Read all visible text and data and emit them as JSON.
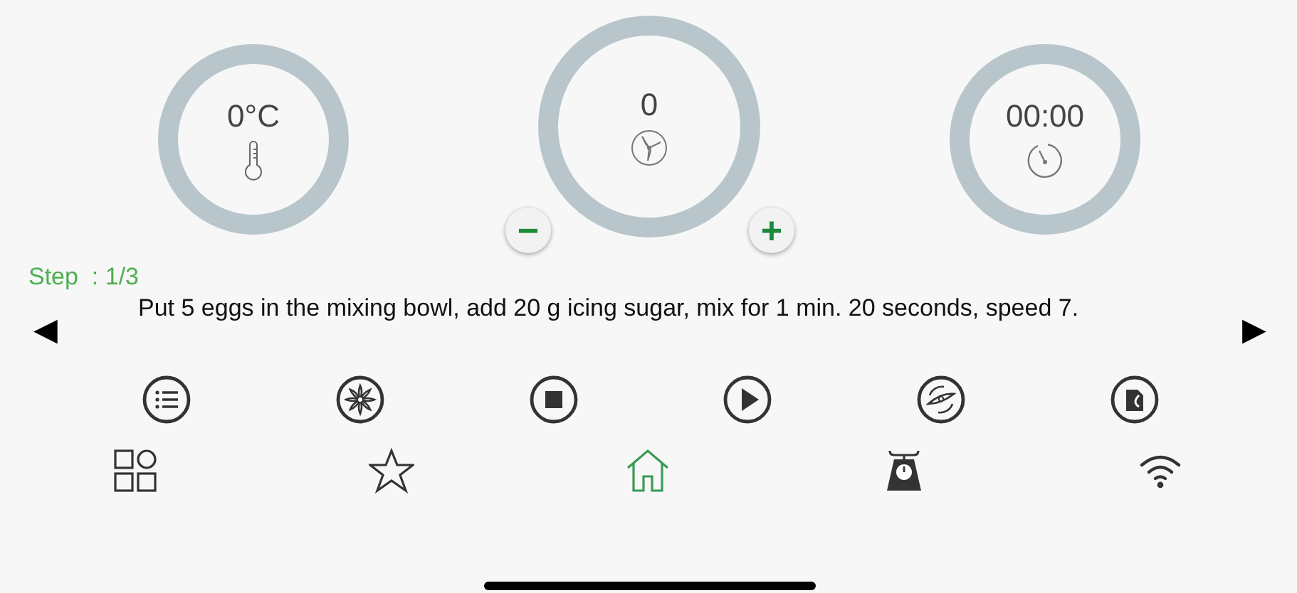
{
  "dials": [
    {
      "kind": "temperature",
      "value": "0°C"
    },
    {
      "kind": "speed",
      "value": "0",
      "minus": "−",
      "plus": "+"
    },
    {
      "kind": "timer",
      "value": "00:00"
    }
  ],
  "step": {
    "label": "Step  : 1/3",
    "instruction": "Put 5 eggs in the mixing bowl, add 20 g icing sugar, mix for 1 min. 20 seconds, speed 7.",
    "prev": "◀",
    "next": "▶"
  },
  "actions": [
    {
      "kind": "list"
    },
    {
      "kind": "blade"
    },
    {
      "kind": "stop"
    },
    {
      "kind": "play"
    },
    {
      "kind": "reverse"
    },
    {
      "kind": "recipe"
    }
  ],
  "tabs": [
    {
      "kind": "apps",
      "selected": false
    },
    {
      "kind": "favorites",
      "selected": false
    },
    {
      "kind": "home",
      "selected": true
    },
    {
      "kind": "scale",
      "selected": false
    },
    {
      "kind": "wifi",
      "selected": false
    }
  ]
}
